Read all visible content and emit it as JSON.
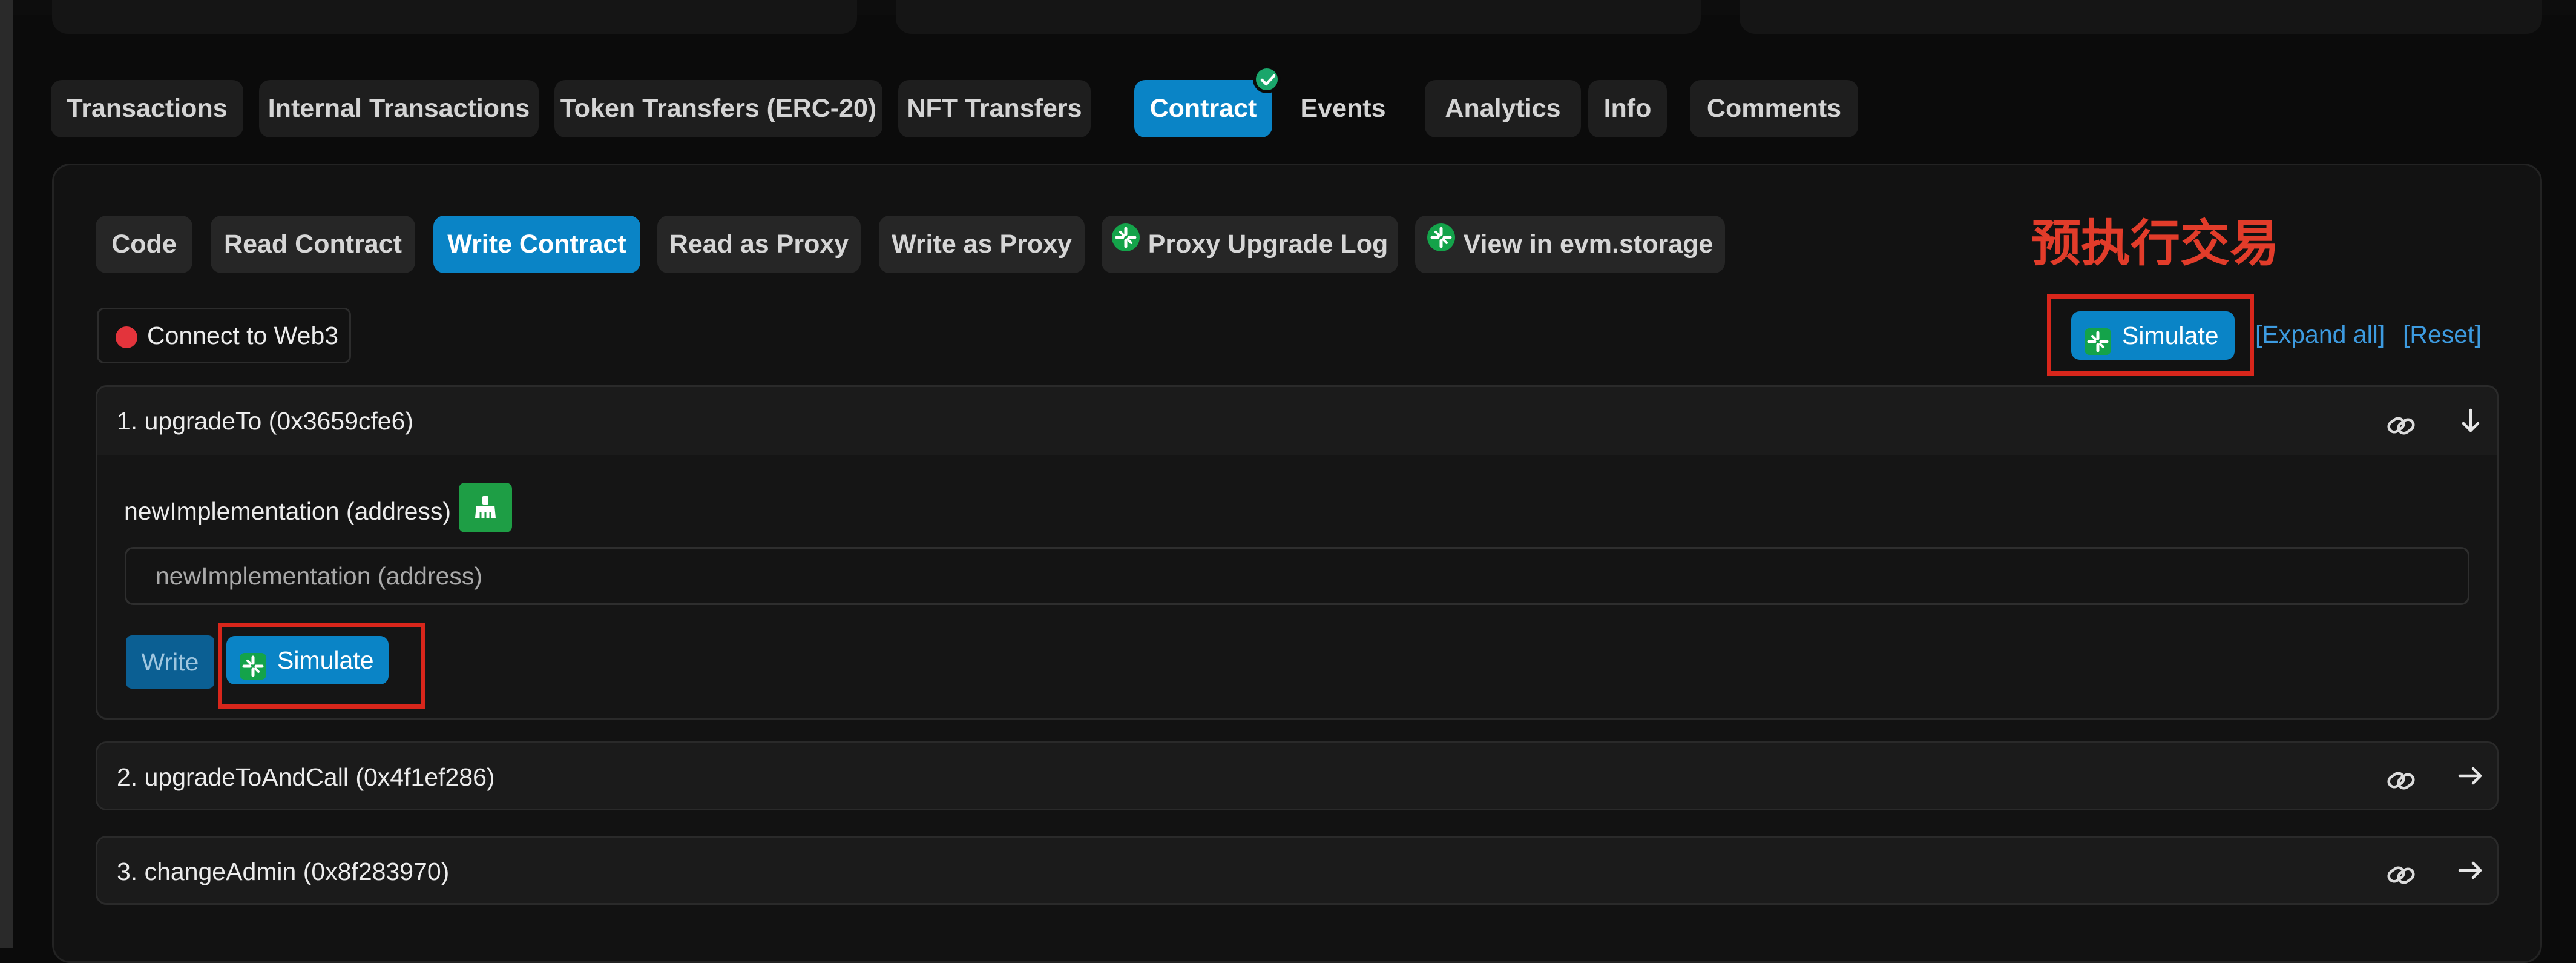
{
  "top_tabs": [
    {
      "label": "Transactions",
      "active": false
    },
    {
      "label": "Internal Transactions",
      "active": false
    },
    {
      "label": "Token Transfers (ERC-20)",
      "active": false
    },
    {
      "label": "NFT Transfers",
      "active": false
    },
    {
      "label": "Contract",
      "active": true,
      "verified": true
    },
    {
      "label": "Events",
      "active": false
    },
    {
      "label": "Analytics",
      "active": false
    },
    {
      "label": "Info",
      "active": false
    },
    {
      "label": "Comments",
      "active": false
    }
  ],
  "sub_tabs": [
    {
      "label": "Code",
      "active": false
    },
    {
      "label": "Read Contract",
      "active": false
    },
    {
      "label": "Write Contract",
      "active": true
    },
    {
      "label": "Read as Proxy",
      "active": false
    },
    {
      "label": "Write as Proxy",
      "active": false
    },
    {
      "label": "Proxy Upgrade Log",
      "active": false,
      "icon": "tenderly-icon"
    },
    {
      "label": "View in evm.storage",
      "active": false,
      "icon": "tenderly-icon"
    }
  ],
  "annotation": {
    "title": "预执行交易",
    "color": "#d8261b"
  },
  "toolbar": {
    "connect_label": "Connect to Web3",
    "connect_status_color": "#e3343c",
    "simulate_label": "Simulate",
    "expand_all_label": "[Expand all]",
    "reset_label": "[Reset]"
  },
  "functions": [
    {
      "title": "1. upgradeTo (0x3659cfe6)",
      "expanded": true,
      "param_label": "newImplementation (address)",
      "param_placeholder": "newImplementation (address)",
      "write_label": "Write",
      "simulate_label": "Simulate"
    },
    {
      "title": "2. upgradeToAndCall (0x4f1ef286)",
      "expanded": false
    },
    {
      "title": "3. changeAdmin (0x8f283970)",
      "expanded": false
    }
  ],
  "colors": {
    "accent": "#0a84c6",
    "success": "#1aa66b",
    "link": "#3d9be0"
  }
}
